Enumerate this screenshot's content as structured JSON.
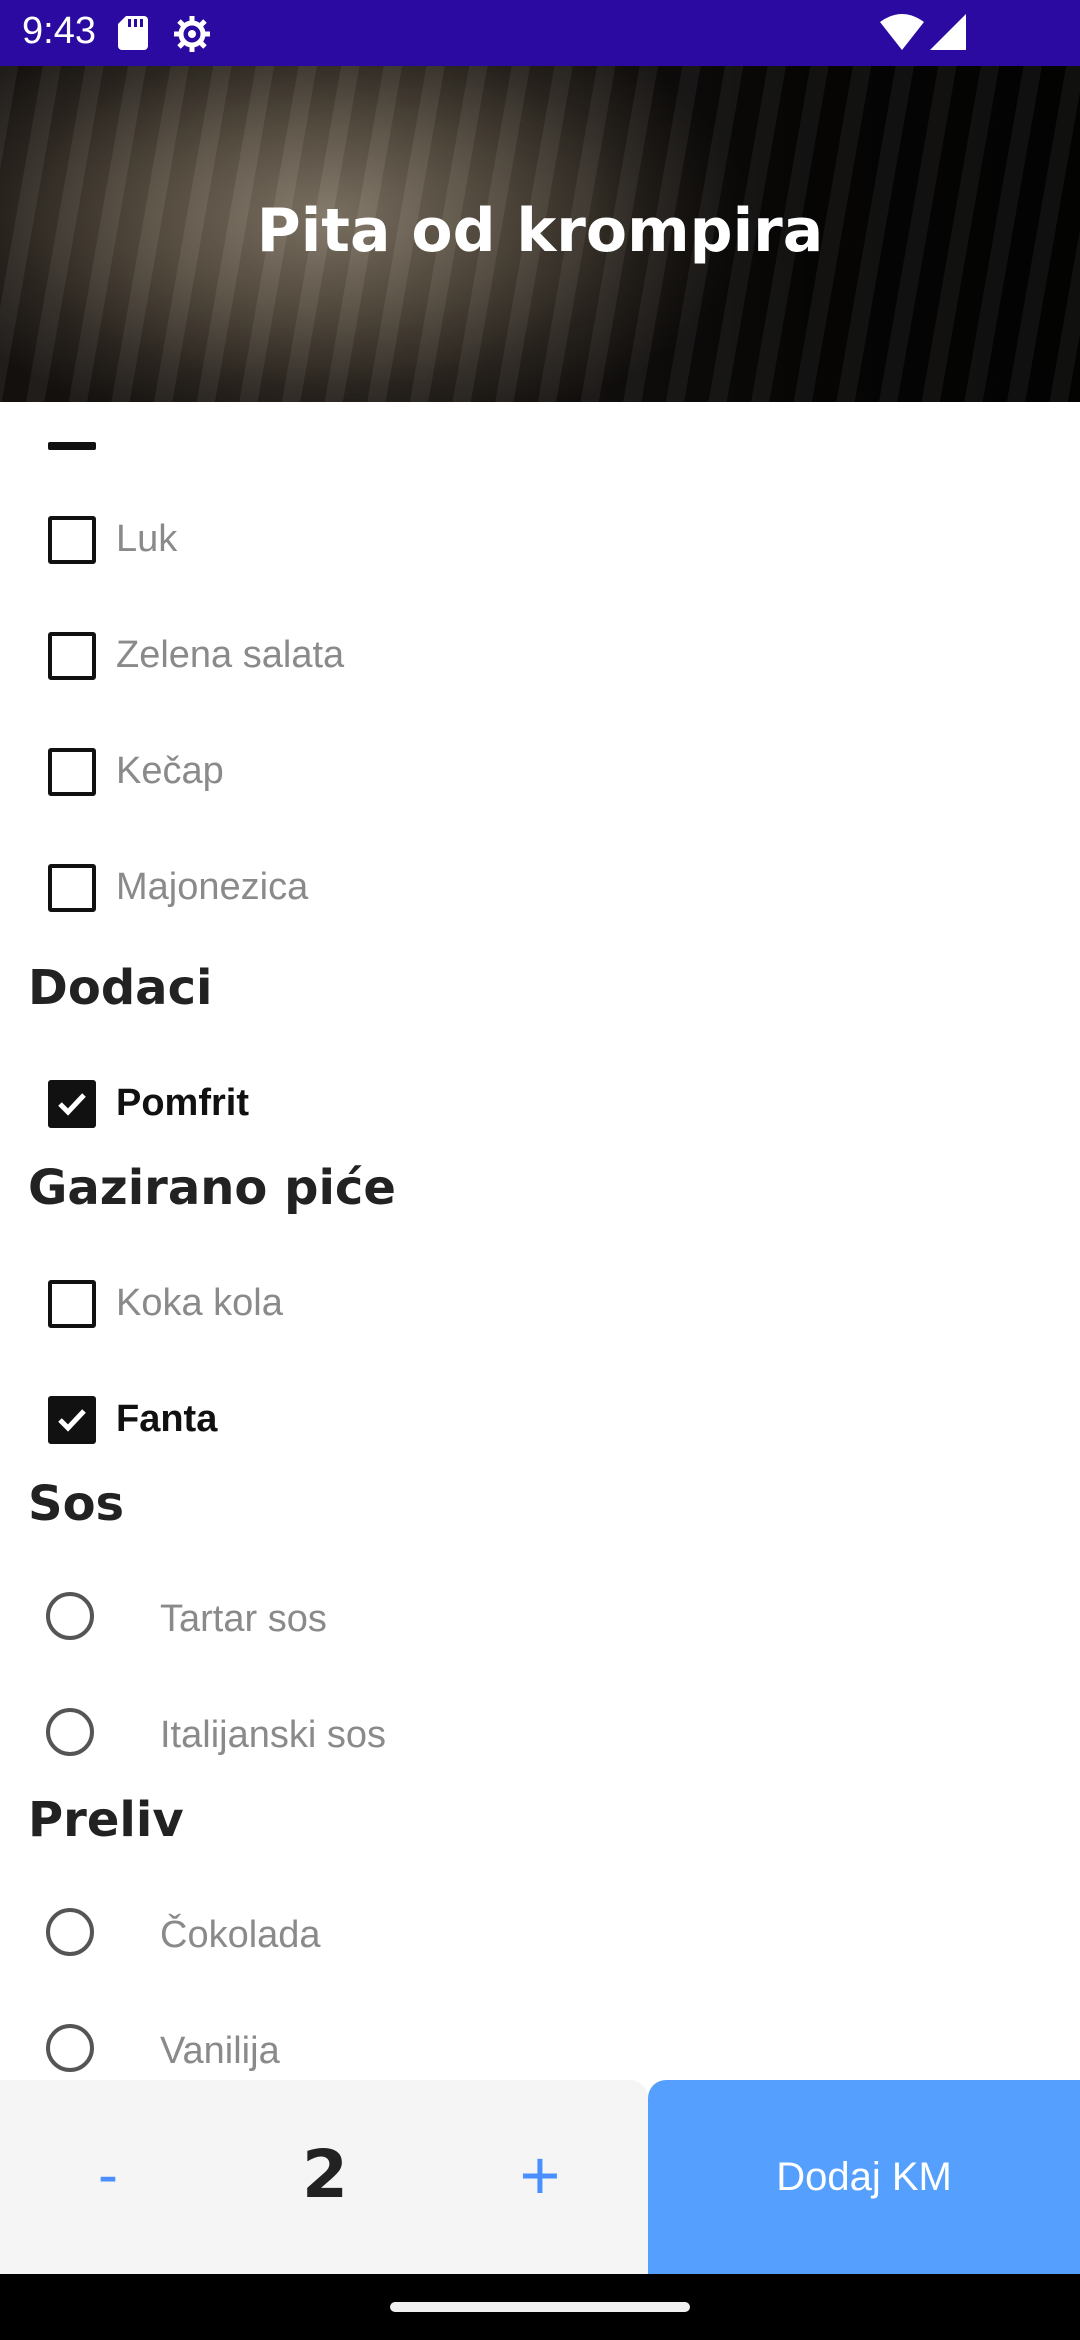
{
  "status": {
    "time": "9:43",
    "icons": [
      "sd-card-icon",
      "gear-icon",
      "wifi-icon",
      "cellular-icon"
    ]
  },
  "header": {
    "title": "Pita od krompira"
  },
  "lists": {
    "toppings": [
      {
        "label": "Luk",
        "checked": false
      },
      {
        "label": "Zelena salata",
        "checked": false
      },
      {
        "label": "Kečap",
        "checked": false
      },
      {
        "label": "Majonezica",
        "checked": false
      }
    ],
    "sections": {
      "dodaci": {
        "title": "Dodaci",
        "items": [
          {
            "label": "Pomfrit",
            "checked": true
          }
        ]
      },
      "gazirano": {
        "title": "Gazirano piće",
        "items": [
          {
            "label": "Koka kola",
            "checked": false
          },
          {
            "label": "Fanta",
            "checked": true
          }
        ]
      },
      "sos": {
        "title": "Sos",
        "items": [
          {
            "label": "Tartar sos"
          },
          {
            "label": "Italijanski sos"
          }
        ]
      },
      "preliv": {
        "title": "Preliv",
        "items": [
          {
            "label": "Čokolada"
          },
          {
            "label": "Vanilija"
          }
        ]
      }
    }
  },
  "bottom": {
    "minus": "-",
    "quantity": "2",
    "plus": "+",
    "add_label": "Dodaj KM"
  },
  "colors": {
    "status_bar": "#2a0aa0",
    "accent": "#55a0ff",
    "quantity_panel": "#f5f5f5"
  }
}
